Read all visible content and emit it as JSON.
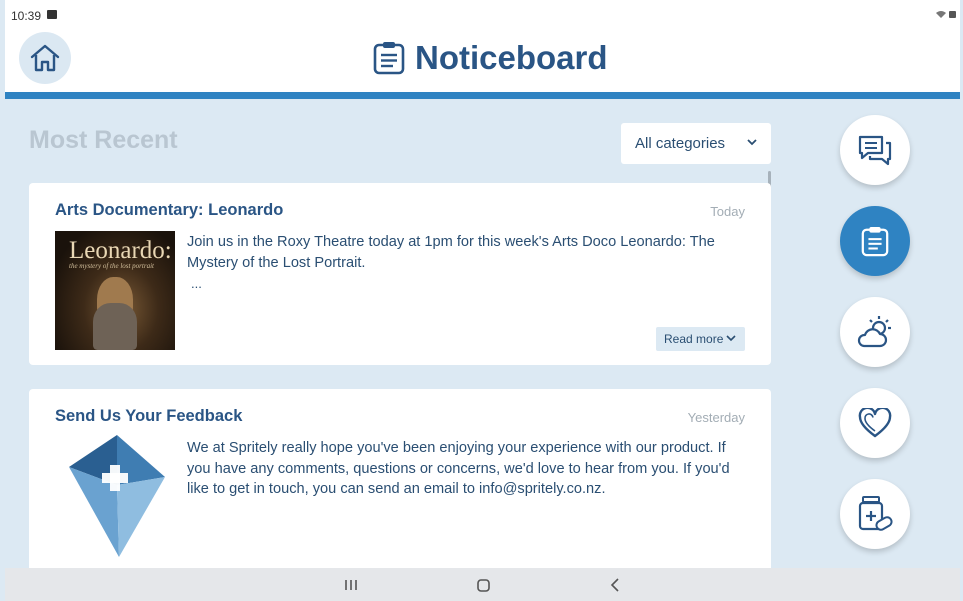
{
  "status_bar": {
    "time": "10:39"
  },
  "header": {
    "title": "Noticeboard"
  },
  "section": {
    "title": "Most Recent"
  },
  "filter": {
    "selected": "All categories"
  },
  "posts": [
    {
      "title": "Arts Documentary: Leonardo",
      "date": "Today",
      "body": "Join us in the Roxy Theatre today at 1pm for this week's Arts Doco Leonardo: The Mystery of the Lost Portrait.",
      "ellipsis": "...",
      "read_more": "Read more",
      "image": {
        "title": "Leonardo:",
        "subtitle": "the mystery of the lost portrait"
      }
    },
    {
      "title": "Send Us Your Feedback",
      "date": "Yesterday",
      "body": "We at Spritely really hope you've been enjoying your experience with our product. If you have any comments, questions or concerns, we'd love to hear from you. If you'd like to get in touch, you can send an email to info@spritely.co.nz."
    }
  ],
  "rail": [
    {
      "icon": "chat-icon"
    },
    {
      "icon": "noticeboard-icon",
      "active": true
    },
    {
      "icon": "weather-icon"
    },
    {
      "icon": "heart-icon"
    },
    {
      "icon": "medication-icon"
    }
  ],
  "colors": {
    "accent": "#2f83c2",
    "title": "#2a5585",
    "background": "#dce9f3"
  }
}
